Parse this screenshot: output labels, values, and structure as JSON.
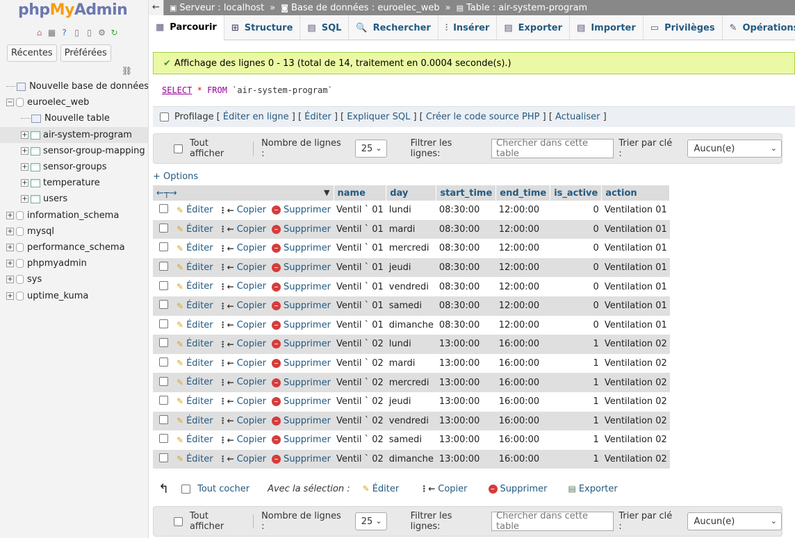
{
  "logo": {
    "php": "php",
    "my": "My",
    "admin": "Admin"
  },
  "sidebar": {
    "tabs": [
      "Récentes",
      "Préférées"
    ],
    "tree": [
      {
        "label": "Nouvelle base de données",
        "kind": "new",
        "level": 0
      },
      {
        "label": "euroelec_web",
        "kind": "db",
        "level": 0,
        "expanded": true
      },
      {
        "label": "Nouvelle table",
        "kind": "new",
        "level": 1
      },
      {
        "label": "air-system-program",
        "kind": "table",
        "level": 1,
        "active": true
      },
      {
        "label": "sensor-group-mapping",
        "kind": "table",
        "level": 1
      },
      {
        "label": "sensor-groups",
        "kind": "table",
        "level": 1
      },
      {
        "label": "temperature",
        "kind": "table",
        "level": 1
      },
      {
        "label": "users",
        "kind": "table",
        "level": 1
      },
      {
        "label": "information_schema",
        "kind": "db",
        "level": 0
      },
      {
        "label": "mysql",
        "kind": "db",
        "level": 0
      },
      {
        "label": "performance_schema",
        "kind": "db",
        "level": 0
      },
      {
        "label": "phpmyadmin",
        "kind": "db",
        "level": 0
      },
      {
        "label": "sys",
        "kind": "db",
        "level": 0
      },
      {
        "label": "uptime_kuma",
        "kind": "db",
        "level": 0
      }
    ]
  },
  "breadcrumb": {
    "server": "Serveur : localhost",
    "database": "Base de données : euroelec_web",
    "table": "Table : air-system-program",
    "separator": "»"
  },
  "tabs": [
    {
      "label": "Parcourir",
      "icon": "browse-icon",
      "active": true
    },
    {
      "label": "Structure",
      "icon": "structure-icon"
    },
    {
      "label": "SQL",
      "icon": "sql-icon"
    },
    {
      "label": "Rechercher",
      "icon": "search-icon"
    },
    {
      "label": "Insérer",
      "icon": "insert-icon"
    },
    {
      "label": "Exporter",
      "icon": "export-icon"
    },
    {
      "label": "Importer",
      "icon": "import-icon"
    },
    {
      "label": "Privilèges",
      "icon": "privileges-icon"
    },
    {
      "label": "Opérations",
      "icon": "operations-icon"
    }
  ],
  "message": "Affichage des lignes 0 - 13 (total de 14, traitement en 0.0004 seconde(s).)",
  "sql": {
    "select": "SELECT",
    "star": "*",
    "from": "FROM",
    "table": "`air-system-program`"
  },
  "profiling": {
    "label": "Profilage",
    "links": [
      "Éditer en ligne",
      "Éditer",
      "Expliquer SQL",
      "Créer le code source PHP",
      "Actualiser"
    ]
  },
  "nav": {
    "show_all": "Tout afficher",
    "rows_label": "Nombre de lignes :",
    "rows_value": "25",
    "filter_label": "Filtrer les lignes:",
    "filter_placeholder": "Chercher dans cette table",
    "sort_label": "Trier par clé :",
    "sort_value": "Aucun(e)"
  },
  "options_link": "+ Options",
  "table": {
    "columns": [
      "name",
      "day",
      "start_time",
      "end_time",
      "is_active",
      "action"
    ],
    "actions": {
      "edit": "Éditer",
      "copy": "Copier",
      "delete": "Supprimer"
    },
    "rows": [
      [
        "Ventil ` 01",
        "lundi",
        "08:30:00",
        "12:00:00",
        "0",
        "Ventilation 01"
      ],
      [
        "Ventil ` 01",
        "mardi",
        "08:30:00",
        "12:00:00",
        "0",
        "Ventilation 01"
      ],
      [
        "Ventil ` 01",
        "mercredi",
        "08:30:00",
        "12:00:00",
        "0",
        "Ventilation 01"
      ],
      [
        "Ventil ` 01",
        "jeudi",
        "08:30:00",
        "12:00:00",
        "0",
        "Ventilation 01"
      ],
      [
        "Ventil ` 01",
        "vendredi",
        "08:30:00",
        "12:00:00",
        "0",
        "Ventilation 01"
      ],
      [
        "Ventil ` 01",
        "samedi",
        "08:30:00",
        "12:00:00",
        "0",
        "Ventilation 01"
      ],
      [
        "Ventil ` 01",
        "dimanche",
        "08:30:00",
        "12:00:00",
        "0",
        "Ventilation 01"
      ],
      [
        "Ventil ` 02",
        "lundi",
        "13:00:00",
        "16:00:00",
        "1",
        "Ventilation 02"
      ],
      [
        "Ventil ` 02",
        "mardi",
        "13:00:00",
        "16:00:00",
        "1",
        "Ventilation 02"
      ],
      [
        "Ventil ` 02",
        "mercredi",
        "13:00:00",
        "16:00:00",
        "1",
        "Ventilation 02"
      ],
      [
        "Ventil ` 02",
        "jeudi",
        "13:00:00",
        "16:00:00",
        "1",
        "Ventilation 02"
      ],
      [
        "Ventil ` 02",
        "vendredi",
        "13:00:00",
        "16:00:00",
        "1",
        "Ventilation 02"
      ],
      [
        "Ventil ` 02",
        "samedi",
        "13:00:00",
        "16:00:00",
        "1",
        "Ventilation 02"
      ],
      [
        "Ventil ` 02",
        "dimanche",
        "13:00:00",
        "16:00:00",
        "1",
        "Ventilation 02"
      ]
    ]
  },
  "bulk": {
    "check_all": "Tout cocher",
    "with_selection": "Avec la sélection :",
    "edit": "Éditer",
    "copy": "Copier",
    "delete": "Supprimer",
    "export": "Exporter"
  }
}
